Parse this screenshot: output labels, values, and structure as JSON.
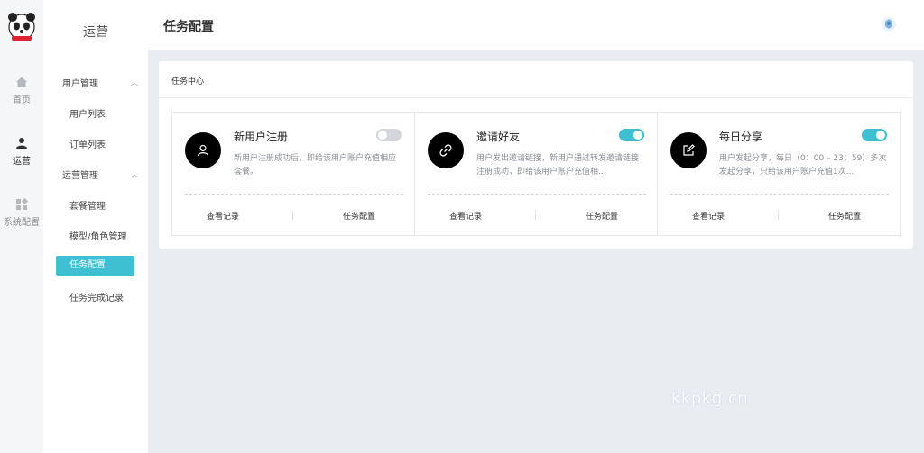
{
  "rail": {
    "items": [
      {
        "label": "首页",
        "icon": "home-icon"
      },
      {
        "label": "运营",
        "icon": "user-icon"
      },
      {
        "label": "系统配置",
        "icon": "grid-icon"
      }
    ]
  },
  "sidebar": {
    "title": "运营",
    "groups": [
      {
        "label": "用户管理",
        "items": [
          "用户列表",
          "订单列表"
        ]
      },
      {
        "label": "运营管理",
        "items": [
          "套餐管理",
          "模型/角色管理",
          "任务配置",
          "任务完成记录"
        ]
      }
    ],
    "active_item": "任务配置"
  },
  "header": {
    "title": "任务配置"
  },
  "panel": {
    "title": "任务中心",
    "tasks": [
      {
        "name": "新用户注册",
        "description": "新用户注册成功后，即给该用户账户充值相应套餐。",
        "enabled": false,
        "icon": "user-outline-icon",
        "view_label": "查看记录",
        "config_label": "任务配置"
      },
      {
        "name": "邀请好友",
        "description": "用户发出邀请链接，新用户通过转发邀请链接注册成功，即给该用户账户充值相...",
        "enabled": true,
        "icon": "link-icon",
        "view_label": "查看记录",
        "config_label": "任务配置"
      },
      {
        "name": "每日分享",
        "description": "用户发起分享，每日（0：00 – 23：59）多次发起分享，只给该用户账户充值1次...",
        "enabled": true,
        "icon": "edit-icon",
        "view_label": "查看记录",
        "config_label": "任务配置"
      }
    ]
  },
  "watermark": "kkpkg.cn",
  "colors": {
    "accent": "#3ebfd2",
    "background": "#e9edf2"
  }
}
